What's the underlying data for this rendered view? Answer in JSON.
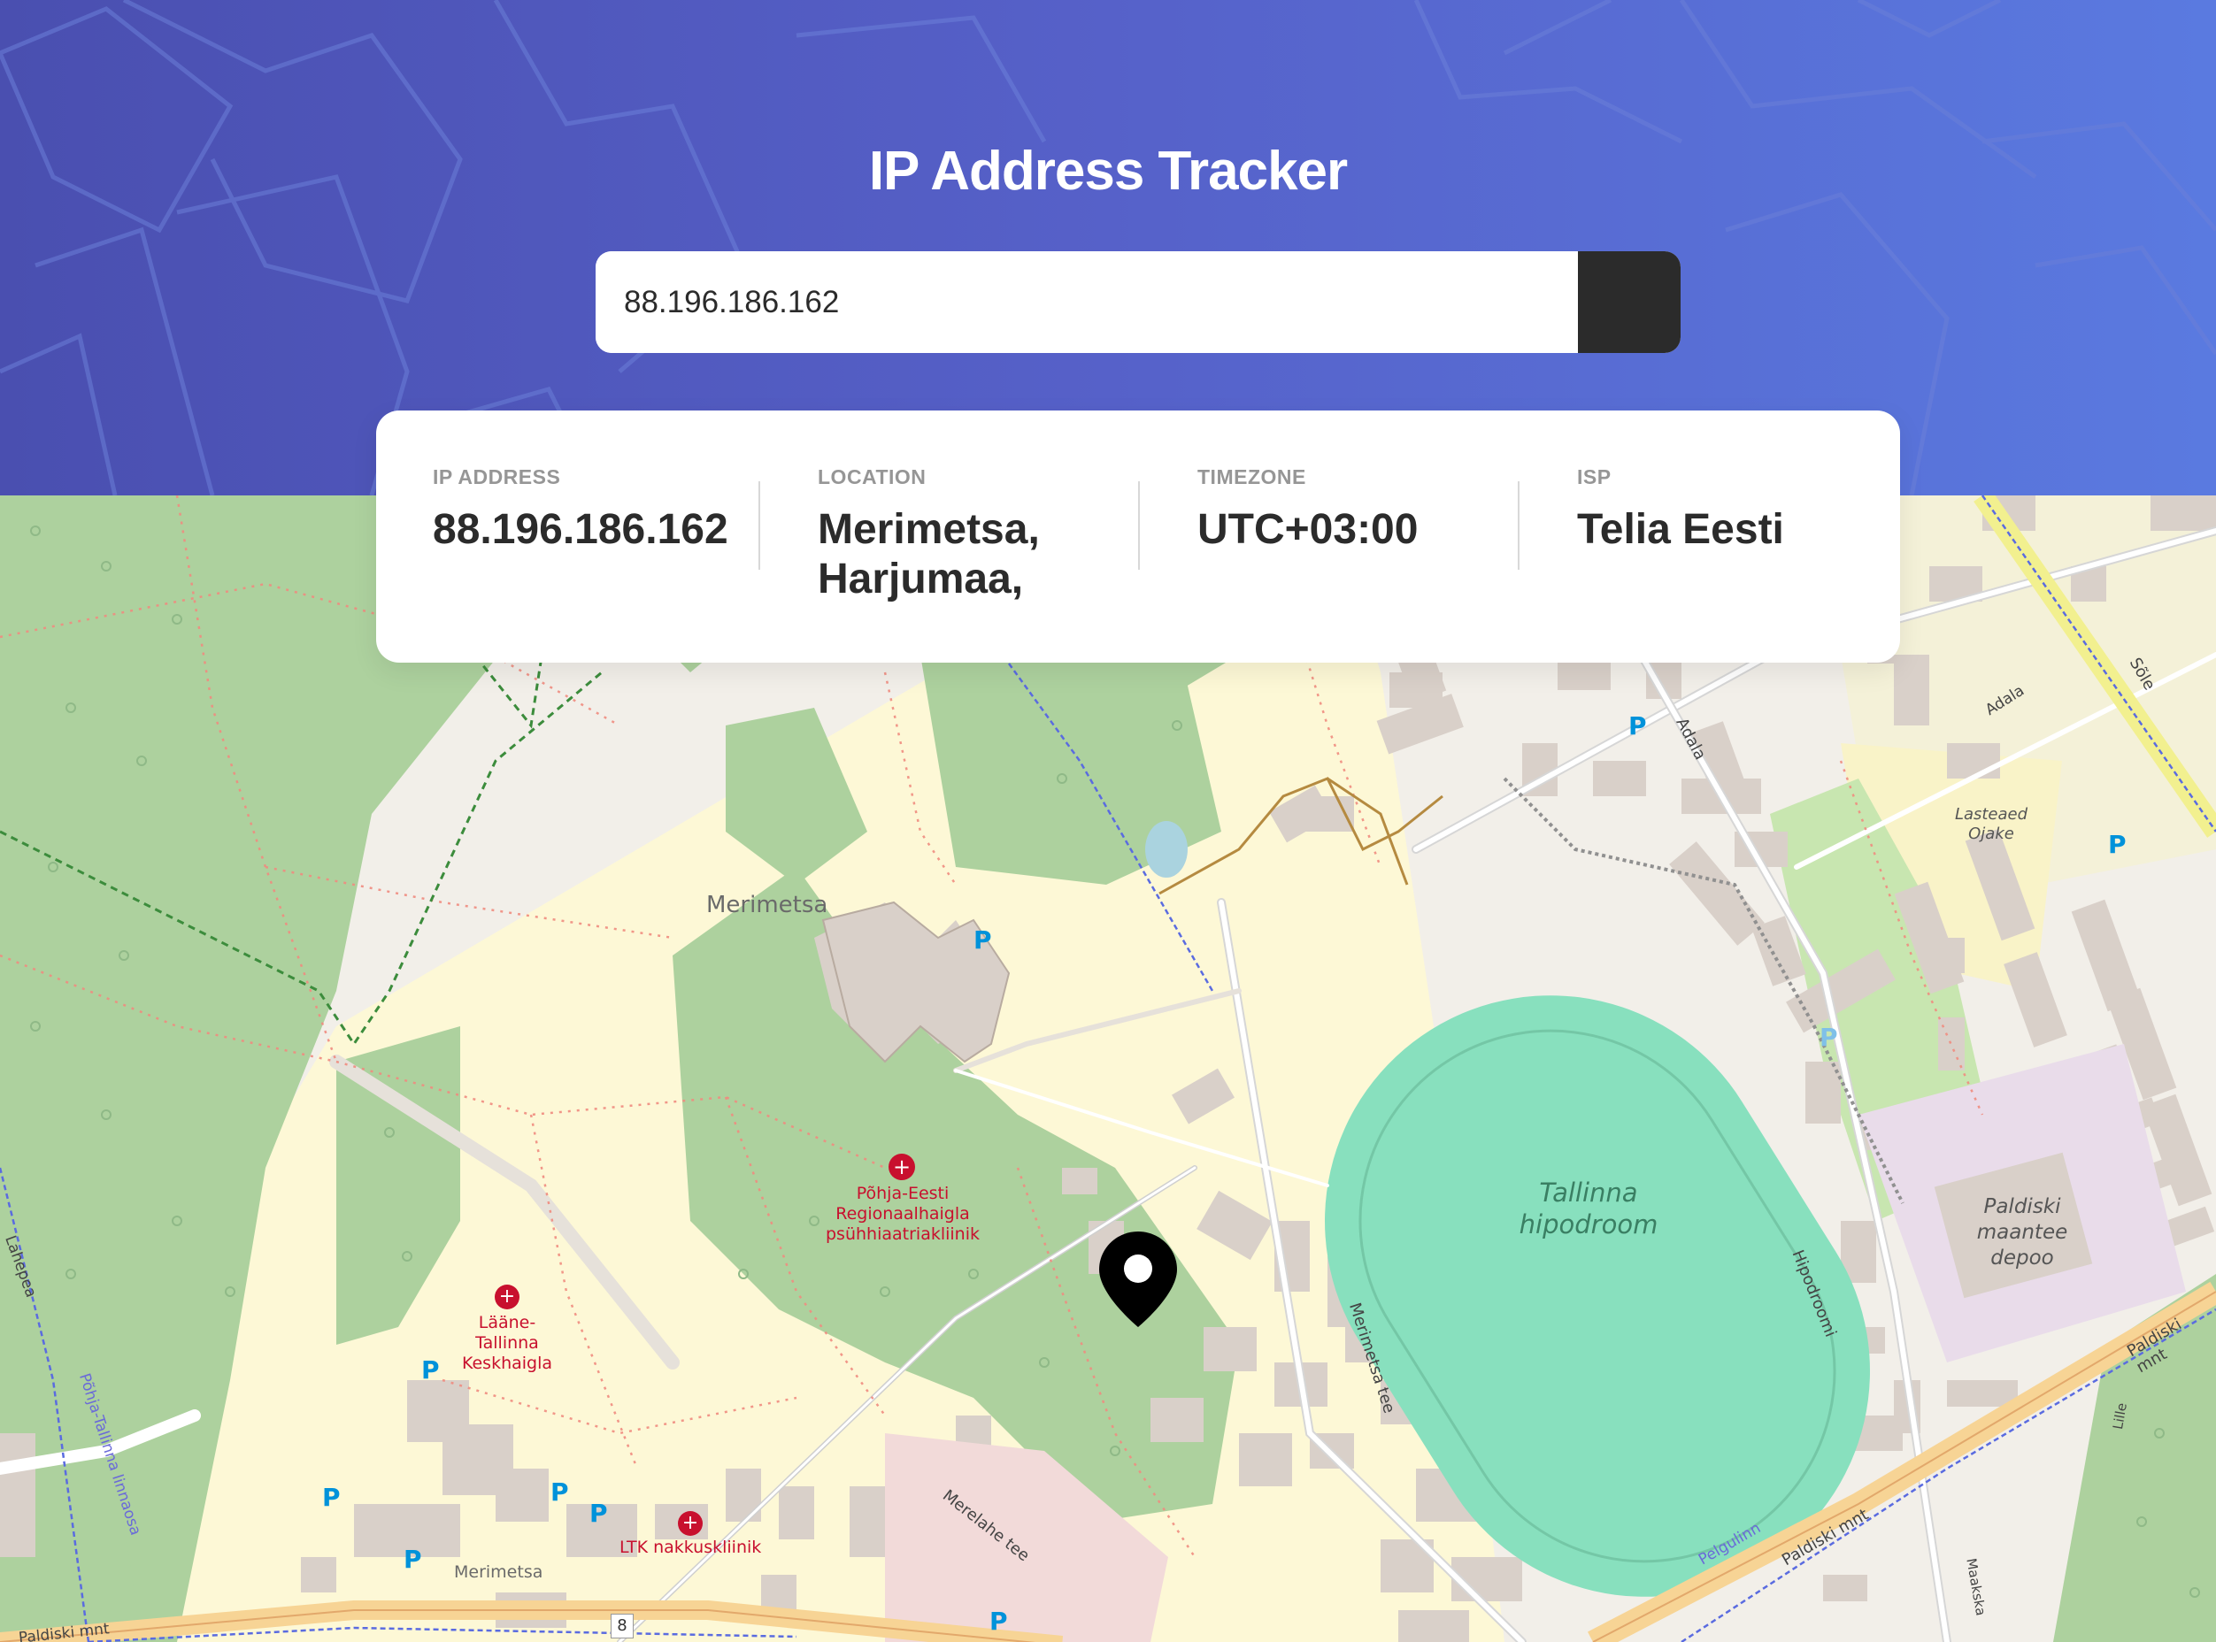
{
  "header": {
    "title": "IP Address Tracker"
  },
  "search": {
    "value": "88.196.186.162",
    "button_icon": "chevron-right-icon"
  },
  "info": {
    "ip": {
      "label": "IP ADDRESS",
      "value": "88.196.186.162"
    },
    "location": {
      "label": "LOCATION",
      "value_line1": "Merimetsa,",
      "value_line2": "Harjumaa,"
    },
    "timezone": {
      "label": "TIMEZONE",
      "value": "UTC+03:00"
    },
    "isp": {
      "label": "ISP",
      "value": "Telia Eesti"
    }
  },
  "map": {
    "marker_icon": "location-pin-icon",
    "labels": {
      "merimetsa": "Merimetsa",
      "merimetsa_small": "Merimetsa",
      "hospital1_l1": "Põhja-Eesti",
      "hospital1_l2": "Regionaalhaigla",
      "hospital1_l3": "psühhiaatriakliinik",
      "hospital2_l1": "Lääne-",
      "hospital2_l2": "Tallinna",
      "hospital2_l3": "Keskhaigla",
      "ltk": "LTK nakkuskliinik",
      "hippo_l1": "Tallinna",
      "hippo_l2": "hipodroom",
      "depot_l1": "Paldiski",
      "depot_l2": "maantee",
      "depot_l3": "depoo",
      "kinder_l1": "Lasteaed",
      "kinder_l2": "Ojake",
      "road_merimetsa_tee": "Merimetsa tee",
      "road_hipodroomi": "Hipodroomi",
      "road_adala": "Adala",
      "road_sole": "Sõle",
      "road_merelahe": "Merelahe tee",
      "road_paldiski": "Paldiski mnt",
      "road_pelgulinn": "Pelgulinn",
      "road_pohja": "Põhja-Tallinna linnaosa",
      "road_lahepea": "Lahepea",
      "road_lille": "Lille",
      "road_maakska": "Maakska",
      "parking": "P",
      "route_number": "8"
    },
    "colors": {
      "forest": "#add19e",
      "residential": "#fdf8d6",
      "land": "#f2efe9",
      "building": "#d9d0c9",
      "track": "#88e0be",
      "road": "#ffffff",
      "hospital_text": "#c8102e",
      "parking": "#0092da"
    }
  }
}
